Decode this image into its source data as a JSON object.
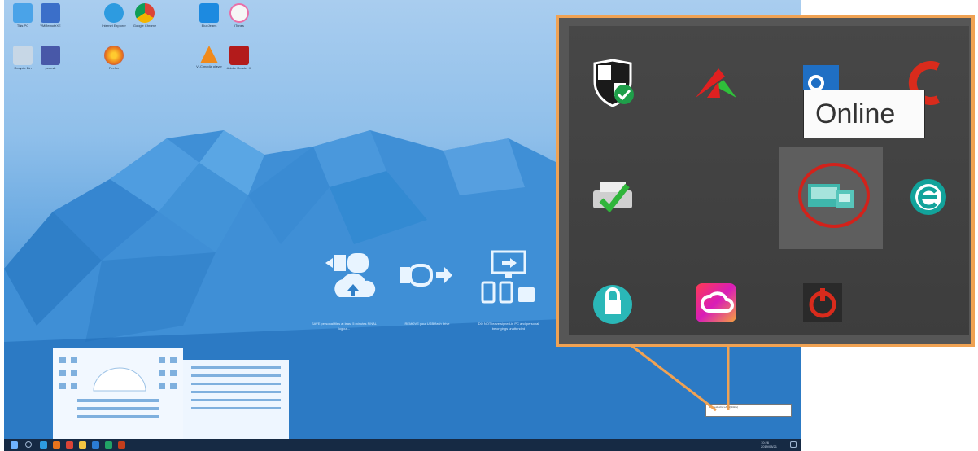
{
  "desktop": {
    "icons": [
      {
        "label": "This PC",
        "name": "this-pc-icon",
        "color": "#4aa3e8"
      },
      {
        "label": "VMRemoteXE",
        "name": "remote-app-icon",
        "color": "#3b6fc9"
      },
      {
        "label": "Internet Explorer",
        "name": "internet-explorer-icon",
        "color": "#2d9be0"
      },
      {
        "label": "Google Chrome",
        "name": "chrome-icon",
        "color": "#db4437"
      },
      {
        "label": "BlueJeans",
        "name": "bluejeans-icon",
        "color": "#1d8ae0"
      },
      {
        "label": "iTunes",
        "name": "itunes-icon",
        "color": "#e96fa8"
      },
      {
        "label": "Recycle Bin",
        "name": "recycle-bin-icon",
        "color": "#9fb7cf"
      },
      {
        "label": "pcdesk",
        "name": "pcdesk-icon",
        "color": "#4858a8"
      },
      {
        "label": "Firefox",
        "name": "firefox-icon",
        "color": "#e8741c"
      },
      {
        "label": "VLC media player",
        "name": "vlc-icon",
        "color": "#f08a1c"
      },
      {
        "label": "Adobe Reader XI",
        "name": "adobe-reader-icon",
        "color": "#b31b1b"
      }
    ],
    "tips": [
      "SAVE personal files at least 5 minutes FINAL logout...",
      "REMOVE your USB flash drive",
      "DO NOT leave signed-in PC and personal belongings unattended"
    ],
    "tray_time": "10:26",
    "tray_date": "2019/08/21",
    "notification_text": "Connected to LAN (Online)"
  },
  "zoom": {
    "border_color": "#f0a253",
    "tooltip": "Online",
    "icons": [
      {
        "name": "windows-defender-shield-icon"
      },
      {
        "name": "red-green-arrow-icon"
      },
      {
        "name": "outlook-icon"
      },
      {
        "name": "ccleaner-icon"
      },
      {
        "name": "printer-check-icon"
      },
      {
        "name": "network-connection-icon"
      },
      {
        "name": "eset-icon"
      },
      {
        "name": "lock-icon"
      },
      {
        "name": "adobe-creative-cloud-icon"
      },
      {
        "name": "power-shutdown-icon"
      }
    ]
  }
}
